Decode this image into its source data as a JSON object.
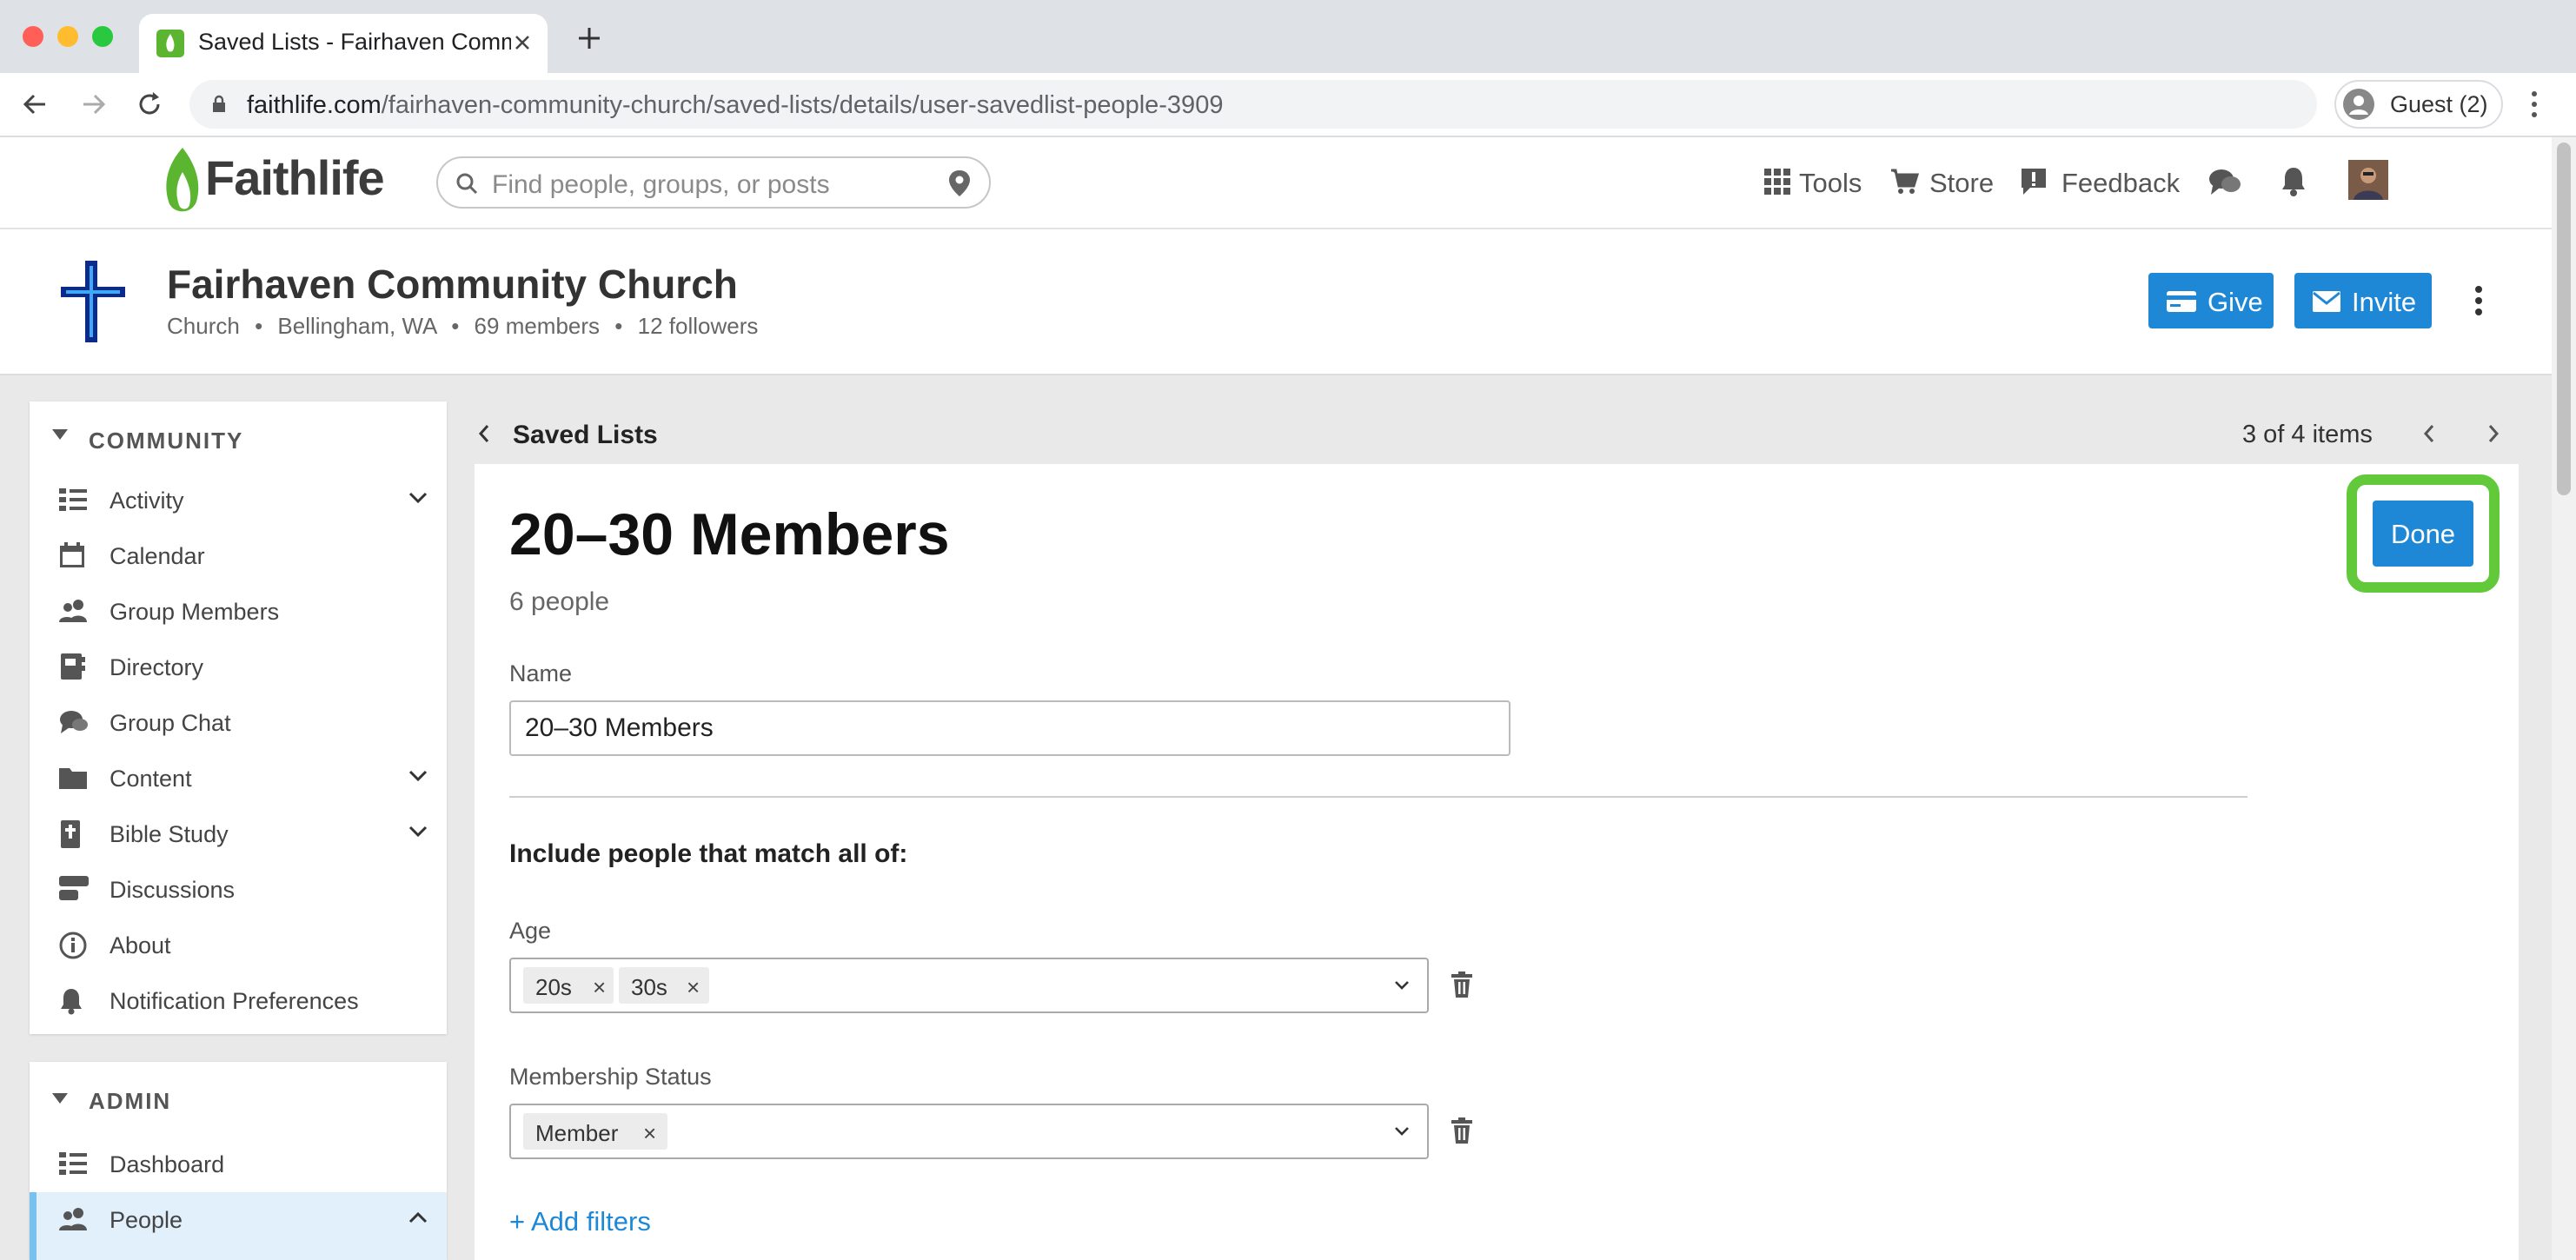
{
  "browser": {
    "tab_title": "Saved Lists - Fairhaven Comm",
    "url_host": "faithlife.com",
    "url_path": "/fairhaven-community-church/saved-lists/details/user-savedlist-people-3909",
    "profile_label": "Guest (2)"
  },
  "site": {
    "logo_text": "Faithlife",
    "search_placeholder": "Find people, groups, or posts",
    "nav": {
      "tools": "Tools",
      "store": "Store",
      "feedback": "Feedback"
    }
  },
  "group": {
    "name": "Fairhaven Community Church",
    "type": "Church",
    "location": "Bellingham, WA",
    "members": "69 members",
    "followers": "12 followers",
    "give_label": "Give",
    "invite_label": "Invite"
  },
  "sidebar": {
    "community_title": "COMMUNITY",
    "community_items": [
      {
        "label": "Activity",
        "icon": "activity-icon",
        "expandable": true
      },
      {
        "label": "Calendar",
        "icon": "calendar-icon",
        "expandable": false
      },
      {
        "label": "Group Members",
        "icon": "people-icon",
        "expandable": false
      },
      {
        "label": "Directory",
        "icon": "directory-icon",
        "expandable": false
      },
      {
        "label": "Group Chat",
        "icon": "chat-icon",
        "expandable": false
      },
      {
        "label": "Content",
        "icon": "folder-icon",
        "expandable": true
      },
      {
        "label": "Bible Study",
        "icon": "bible-icon",
        "expandable": true
      },
      {
        "label": "Discussions",
        "icon": "discussions-icon",
        "expandable": false
      },
      {
        "label": "About",
        "icon": "info-icon",
        "expandable": false
      },
      {
        "label": "Notification Preferences",
        "icon": "bell-icon",
        "expandable": false
      }
    ],
    "admin_title": "ADMIN",
    "admin_items": [
      {
        "label": "Dashboard",
        "icon": "dashboard-icon"
      },
      {
        "label": "People",
        "icon": "people-icon",
        "active": true
      }
    ]
  },
  "main": {
    "breadcrumb": "Saved Lists",
    "pager": "3 of 4 items",
    "title": "20–30 Members",
    "count": "6 people",
    "done_label": "Done",
    "name_label": "Name",
    "name_value": "20–30 Members",
    "filters_heading": "Include people that match all of:",
    "filters": [
      {
        "label": "Age",
        "chips": [
          "20s",
          "30s"
        ]
      },
      {
        "label": "Membership Status",
        "chips": [
          "Member"
        ]
      }
    ],
    "add_filters": "+ Add filters"
  },
  "colors": {
    "accent": "#1e88d6",
    "highlight": "#62c93b",
    "brand_green": "#5cb531"
  }
}
